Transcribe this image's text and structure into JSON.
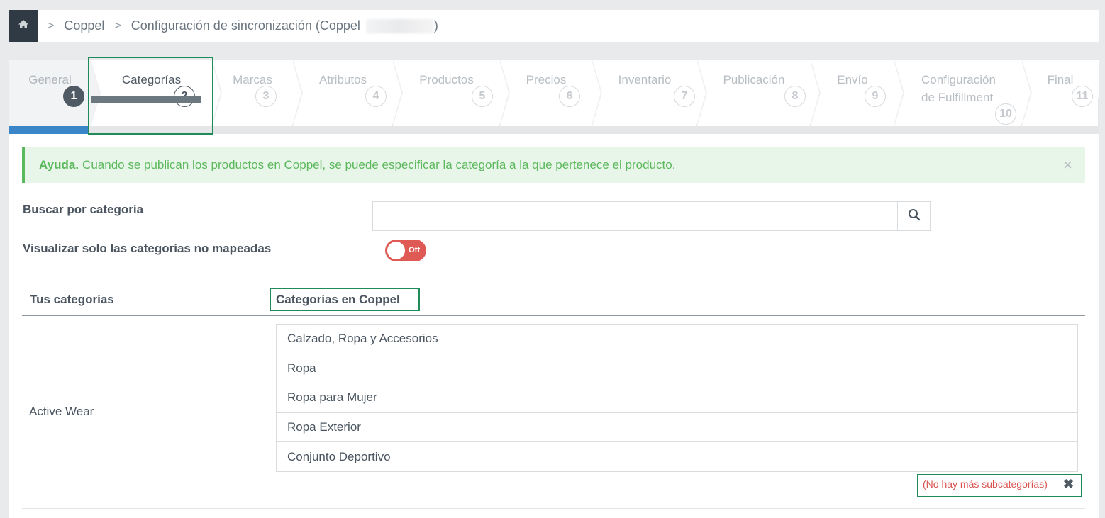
{
  "breadcrumb": {
    "home_icon": "home-icon",
    "items": [
      "Coppel",
      "Configuración de sincronización (Coppel"
    ],
    "tail": ")"
  },
  "steps": [
    {
      "label": "General",
      "num": "1",
      "state": "done"
    },
    {
      "label": "Categorías",
      "num": "2",
      "state": "active"
    },
    {
      "label": "Marcas",
      "num": "3",
      "state": "pending"
    },
    {
      "label": "Atributos",
      "num": "4",
      "state": "pending"
    },
    {
      "label": "Productos",
      "num": "5",
      "state": "pending"
    },
    {
      "label": "Precios",
      "num": "6",
      "state": "pending"
    },
    {
      "label": "Inventario",
      "num": "7",
      "state": "pending"
    },
    {
      "label": "Publicación",
      "num": "8",
      "state": "pending"
    },
    {
      "label": "Envío",
      "num": "9",
      "state": "pending"
    },
    {
      "label": "Configuración de Fulfillment",
      "num": "10",
      "state": "pending"
    },
    {
      "label": "Final",
      "num": "11",
      "state": "pending"
    }
  ],
  "progress": {
    "fraction": 0.0723,
    "color": "#3a86c8"
  },
  "alert": {
    "title": "Ayuda.",
    "text": "Cuando se publican los productos en Coppel, se puede especificar la categoría a la que pertenece el producto.",
    "close": "×"
  },
  "search": {
    "label": "Buscar por categoría",
    "value": "",
    "icon": "search-icon"
  },
  "filter": {
    "label": "Visualizar solo las categorías no mapeadas",
    "toggle_text": "Off",
    "toggle_color": "#e05a55"
  },
  "table": {
    "col_yours": "Tus categorías",
    "col_coppel": "Categorías en Coppel",
    "row": {
      "label": "Active Wear",
      "path": [
        "Calzado, Ropa y Accesorios",
        "Ropa",
        "Ropa para Mujer",
        "Ropa Exterior",
        "Conjunto Deportivo"
      ],
      "no_more": "(No hay más subcategorías)",
      "clear": "✖"
    }
  },
  "colors": {
    "accent": "#1f8a5a",
    "alert_green": "#5cb85c",
    "danger": "#d9534f",
    "dark": "#2f3a44"
  }
}
